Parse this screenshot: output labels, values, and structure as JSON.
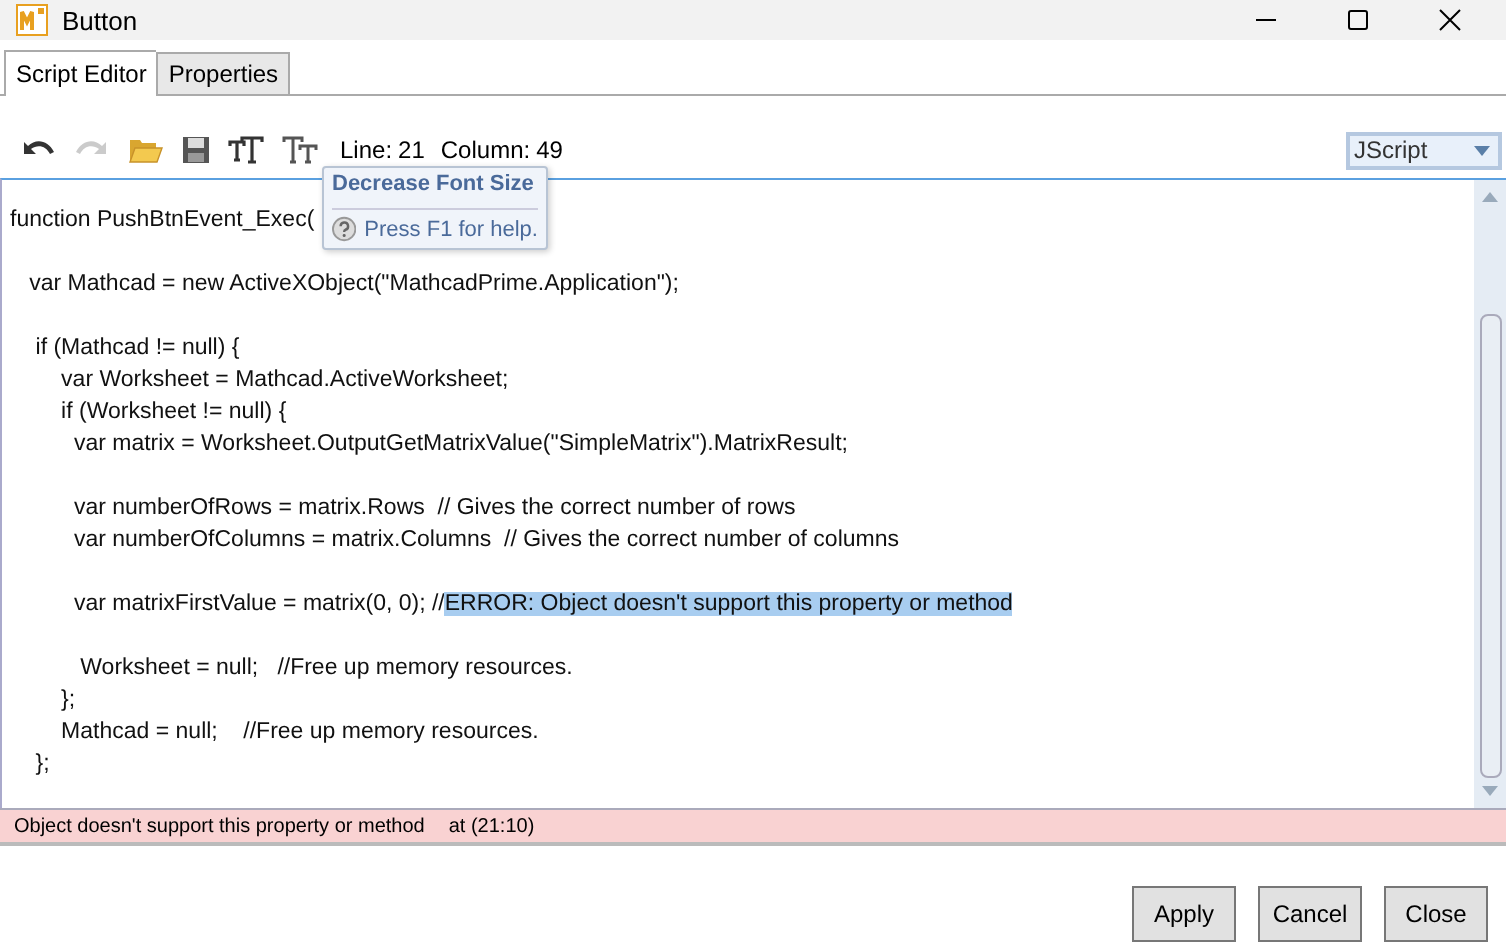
{
  "window": {
    "title": "Button"
  },
  "tabs": [
    {
      "label": "Script Editor",
      "selected": true
    },
    {
      "label": "Properties",
      "selected": false
    }
  ],
  "toolbar": {
    "tools": [
      {
        "kind": "undo",
        "disabled": false
      },
      {
        "kind": "redo",
        "disabled": true
      },
      {
        "kind": "open",
        "disabled": false
      },
      {
        "kind": "save",
        "disabled": false
      },
      {
        "kind": "font-up",
        "disabled": false
      },
      {
        "kind": "font-down",
        "disabled": false
      }
    ],
    "line_label": "Line:",
    "line": "21",
    "column_label": "Column:",
    "column": "49",
    "language": "JScript"
  },
  "tooltip": {
    "title": "Decrease Font Size",
    "help": "Press F1 for help."
  },
  "code_blocks": [
    {
      "lines": [
        {
          "text": "function PushBtnEvent_Exec("
        }
      ]
    },
    {
      "lines": [
        {
          "text": "   var Mathcad = new ActiveXObject(\"MathcadPrime.Application\");"
        }
      ]
    },
    {
      "lines": [
        {
          "text": "    if (Mathcad != null) {"
        },
        {
          "text": "        var Worksheet = Mathcad.ActiveWorksheet;"
        },
        {
          "text": "        if (Worksheet != null) {"
        },
        {
          "text": "          var matrix = Worksheet.OutputGetMatrixValue(\"SimpleMatrix\").MatrixResult;"
        }
      ]
    },
    {
      "lines": [
        {
          "text": "          var numberOfRows = matrix.Rows  // Gives the correct number of rows"
        },
        {
          "text": "          var numberOfColumns = matrix.Columns  // Gives the correct number of columns"
        }
      ]
    },
    {
      "lines": [
        {
          "text": "          var matrixFirstValue = matrix(0, 0); //",
          "selected_text": "ERROR: Object doesn't support this property or method"
        }
      ]
    },
    {
      "lines": [
        {
          "text": "           Worksheet = null;   //Free up memory resources."
        },
        {
          "text": "        };"
        },
        {
          "text": "        Mathcad = null;    //Free up memory resources."
        },
        {
          "text": "    };"
        }
      ]
    }
  ],
  "error_bar": {
    "message": "Object doesn't support this property or method",
    "location": "at (21:10)"
  },
  "buttons": [
    "Apply",
    "Cancel",
    "Close"
  ]
}
